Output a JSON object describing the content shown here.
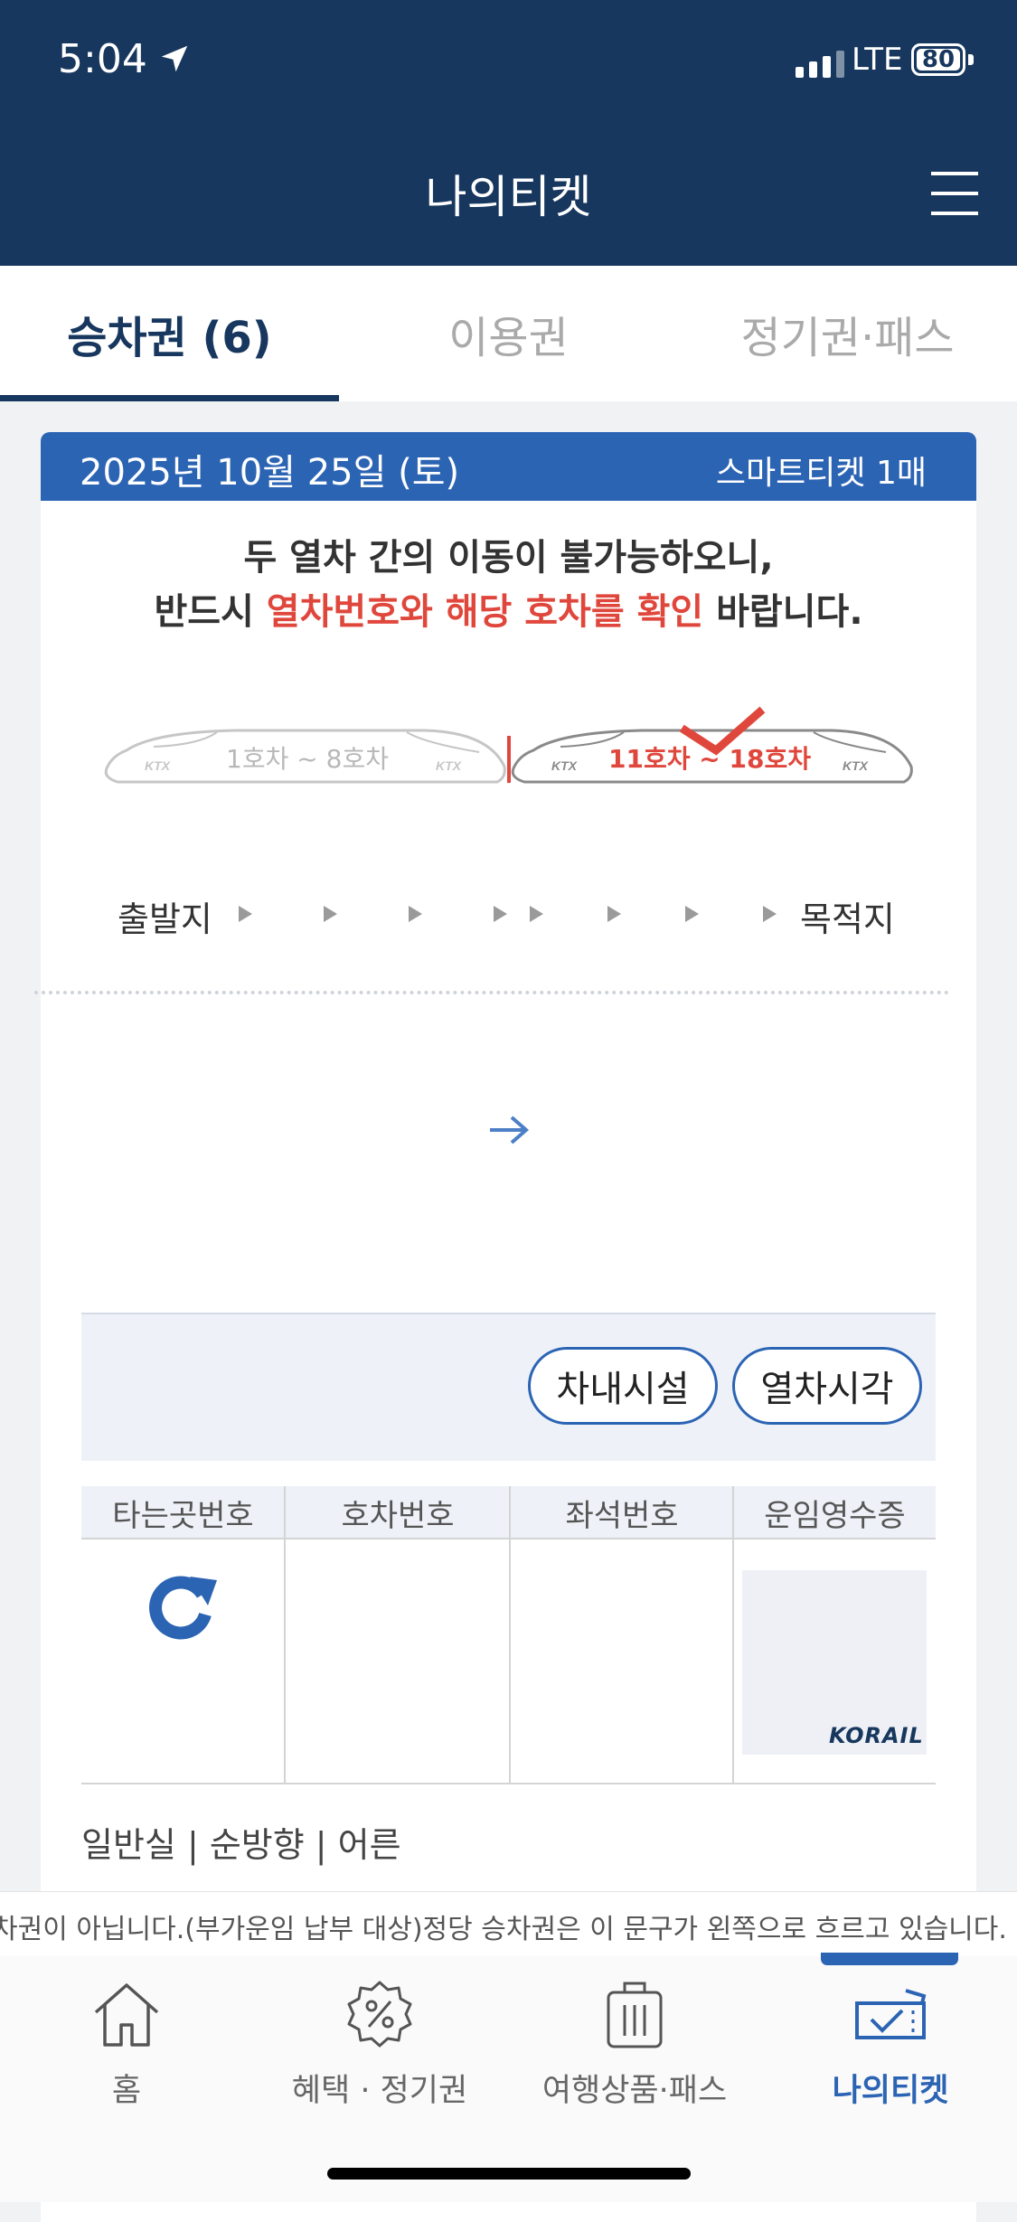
{
  "status_bar": {
    "time": "5:04",
    "network": "LTE",
    "battery": "80"
  },
  "header": {
    "title": "나의티켓"
  },
  "tabs": [
    {
      "label": "승차권 (6)",
      "active": true
    },
    {
      "label": "이용권",
      "active": false
    },
    {
      "label": "정기권·패스",
      "active": false
    }
  ],
  "ticket": {
    "date": "2025년 10월 25일 (토)",
    "ticket_type": "스마트티켓 1매",
    "notice": {
      "line1": "두 열차 간의 이동이 불가능하오니,",
      "line2_pre": "반드시 ",
      "line2_highlight": "열차번호와 해당 호차를 확인",
      "line2_post": " 바랍니다."
    },
    "train_diagram": {
      "left_cars": "1호차 ~ 8호차",
      "right_cars": "11호차 ~ 18호차",
      "brand": "KTX",
      "selected": "right"
    },
    "route": {
      "departure": "출발지",
      "arrival": "목적지"
    },
    "buttons": {
      "facilities": "차내시설",
      "timetable": "열차시각"
    },
    "table": {
      "headers": [
        "타는곳번호",
        "호차번호",
        "좌석번호",
        "운임영수증"
      ],
      "receipt_logo": "KORAIL"
    },
    "seat_info": "일반실 | 순방향 | 어른"
  },
  "ticker_text": "차권이 아닙니다.(부가운임 납부 대상)정당 승차권은 이 문구가 왼쪽으로 흐르고 있습니다.",
  "bottom_nav": [
    {
      "label": "홈",
      "icon": "home-icon",
      "active": false
    },
    {
      "label": "혜택 · 정기권",
      "icon": "discount-badge-icon",
      "active": false
    },
    {
      "label": "여행상품·패스",
      "icon": "luggage-icon",
      "active": false
    },
    {
      "label": "나의티켓",
      "icon": "ticket-check-icon",
      "active": true
    }
  ],
  "colors": {
    "header": "#17375e",
    "accent": "#2c64b4",
    "highlight": "#e0473c"
  }
}
